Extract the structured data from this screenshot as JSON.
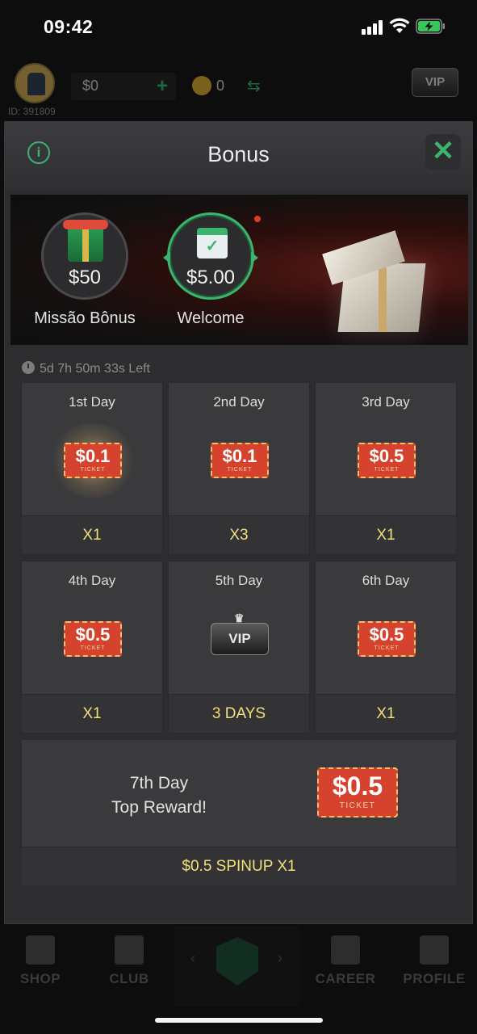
{
  "status_bar": {
    "time": "09:42"
  },
  "top_bar": {
    "user_id": "ID: 391809",
    "cash": "$0",
    "coins": "0",
    "vip_badge": "VIP"
  },
  "modal": {
    "title": "Bonus",
    "tabs": [
      {
        "amount": "$50",
        "label": "Missão Bônus"
      },
      {
        "amount": "$5.00",
        "label": "Welcome"
      }
    ],
    "countdown": "5d 7h 50m 33s Left",
    "days": [
      {
        "label": "1st Day",
        "ticket": "$0.1",
        "reward": "X1"
      },
      {
        "label": "2nd Day",
        "ticket": "$0.1",
        "reward": "X3"
      },
      {
        "label": "3rd Day",
        "ticket": "$0.5",
        "reward": "X1"
      },
      {
        "label": "4th Day",
        "ticket": "$0.5",
        "reward": "X1"
      },
      {
        "label": "5th Day",
        "ticket": "VIP",
        "reward": "3 DAYS"
      },
      {
        "label": "6th Day",
        "ticket": "$0.5",
        "reward": "X1"
      }
    ],
    "ticket_caption": "TICKET",
    "day7": {
      "line1": "7th Day",
      "line2": "Top Reward!",
      "ticket": "$0.5",
      "reward": "$0.5 SPINUP X1"
    }
  },
  "bottom_nav": {
    "items": [
      "SHOP",
      "CLUB",
      "CAREER",
      "PROFILE"
    ]
  },
  "colors": {
    "accent_green": "#3db46d",
    "reward_yellow": "#efe07a",
    "ticket_red": "#d5432f"
  }
}
